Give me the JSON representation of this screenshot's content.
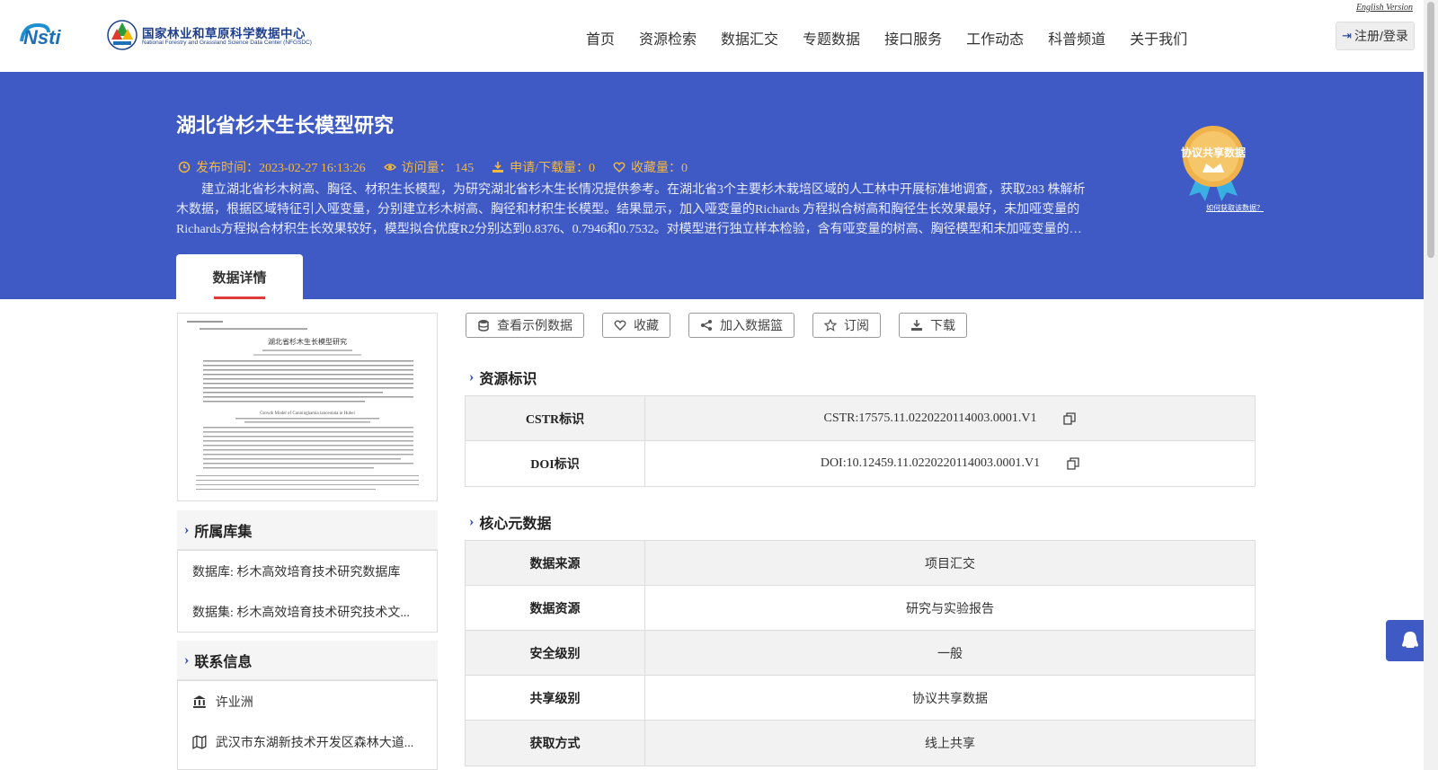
{
  "header": {
    "english_link": "English Version",
    "logo_text": "Nsti",
    "org_name_cn": "国家林业和草原科学数据中心",
    "org_name_en": "National Forestry and Grassland Science Data Center (NFGSDC)",
    "nav": [
      "首页",
      "资源检索",
      "数据汇交",
      "专题数据",
      "接口服务",
      "工作动态",
      "科普频道",
      "关于我们"
    ],
    "login_label": "注册/登录"
  },
  "banner": {
    "title": "湖北省杉木生长模型研究",
    "publish_time": "发布时间：2023-02-27 16:13:26",
    "visits": "访问量： 145",
    "downloads": "申请/下载量：0",
    "favorites": "收藏量：0",
    "abstract": "建立湖北省杉木树高、胸径、材积生长模型，为研究湖北省杉木生长情况提供参考。在湖北省3个主要杉木栽培区域的人工林中开展标准地调查，获取283 株解析木数据，根据区域特征引入哑变量，分别建立杉木树高、胸径和材积生长模型。结果显示，加入哑变量的Richards 方程拟合树高和胸径生长效果最好，未加哑变量的Richards方程拟合材积生长效果较好，模型拟合优度R2分别达到0.8376、0.7946和0.7532。对模型进行独立样本检验，含有哑变量的树高、胸径模型和未加哑变量的…",
    "badge_text": "协议共享数据",
    "badge_link": "如何获取该数据？",
    "tab_label": "数据详情"
  },
  "thumbnail": {
    "paper_title": "湖北省杉木生长模型研究",
    "paper_title_en": "Growth Model of Cunninghamia lanceolata in Hubei"
  },
  "sidebar": {
    "collection_title": "所属库集",
    "collection_items": [
      "数据库: 杉木高效培育技术研究数据库",
      "数据集: 杉木高效培育技术研究技术文..."
    ],
    "contact_title": "联系信息",
    "contact_items": [
      {
        "icon": "institution-icon",
        "text": "许业洲"
      },
      {
        "icon": "map-icon",
        "text": "武汉市东湖新技术开发区森林大道..."
      }
    ]
  },
  "actions": [
    {
      "icon": "database-icon",
      "label": "查看示例数据"
    },
    {
      "icon": "heart-icon",
      "label": "收藏"
    },
    {
      "icon": "share-icon",
      "label": "加入数据篮"
    },
    {
      "icon": "star-icon",
      "label": "订阅"
    },
    {
      "icon": "download-icon",
      "label": "下载"
    }
  ],
  "resource_id": {
    "title": "资源标识",
    "rows": [
      {
        "key": "CSTR标识",
        "value": "CSTR:17575.11.0220220114003.0001.V1"
      },
      {
        "key": "DOI标识",
        "value": "DOI:10.12459.11.0220220114003.0001.V1"
      }
    ]
  },
  "core_meta": {
    "title": "核心元数据",
    "rows": [
      {
        "key": "数据来源",
        "value": "项目汇交"
      },
      {
        "key": "数据资源",
        "value": "研究与实验报告"
      },
      {
        "key": "安全级别",
        "value": "一般"
      },
      {
        "key": "共享级别",
        "value": "协议共享数据"
      },
      {
        "key": "获取方式",
        "value": "线上共享"
      }
    ]
  },
  "colors": {
    "banner": "#3f5ac4",
    "accent_gold": "#f6b93b",
    "brand_blue": "#1e3f8e",
    "tab_underline": "#e03a3a"
  }
}
